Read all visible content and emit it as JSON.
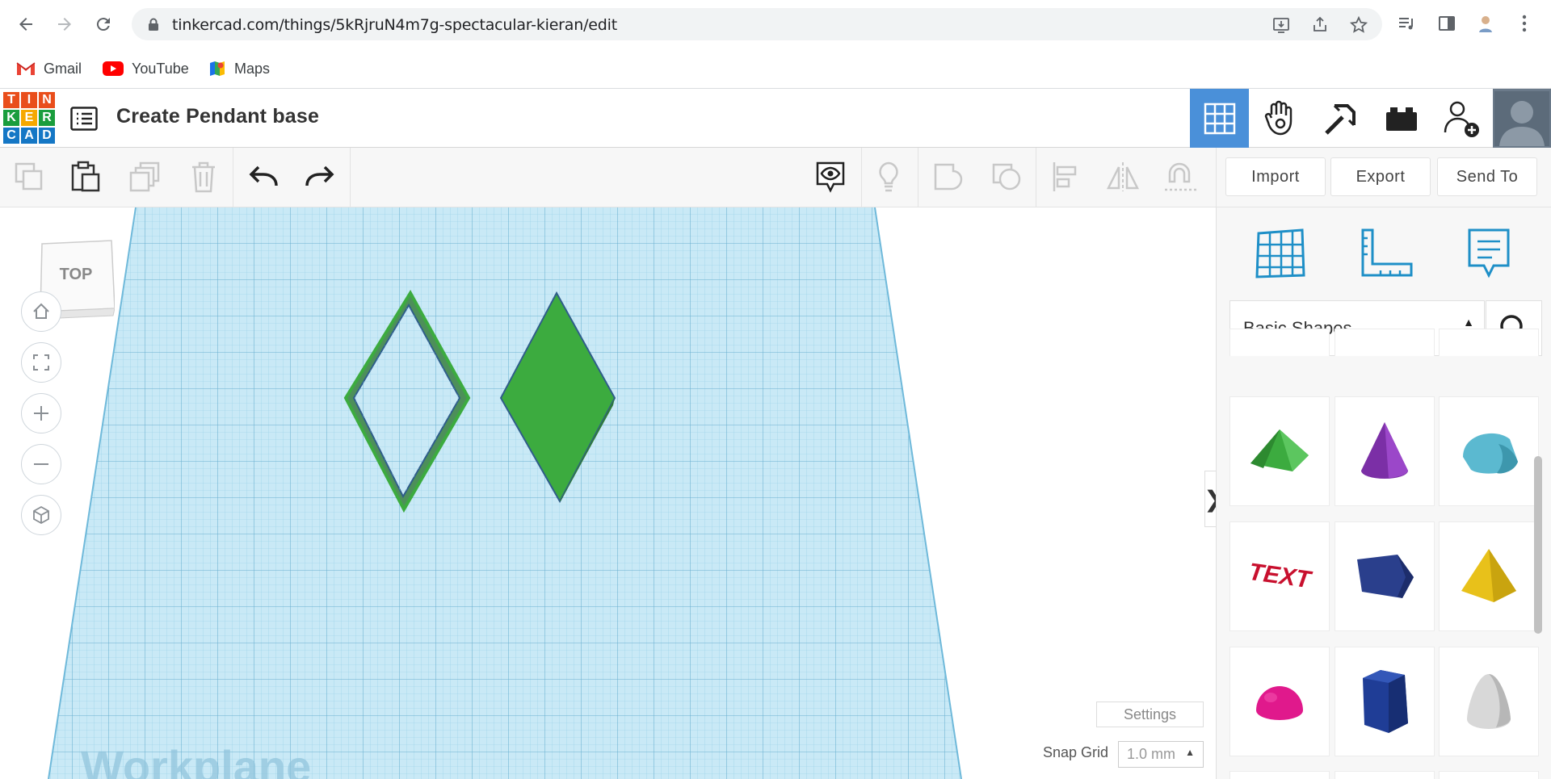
{
  "browser": {
    "url": "tinkercad.com/things/5kRjruN4m7g-spectacular-kieran/edit",
    "bookmarks": [
      {
        "label": "Gmail"
      },
      {
        "label": "YouTube"
      },
      {
        "label": "Maps"
      }
    ]
  },
  "header": {
    "logo_letters": [
      "T",
      "I",
      "N",
      "K",
      "E",
      "R",
      "C",
      "A",
      "D"
    ],
    "logo_colors": [
      "#e94e1b",
      "#e94e1b",
      "#e94e1b",
      "#1a9d3d",
      "#f6a800",
      "#1a9d3d",
      "#1577c5",
      "#1577c5",
      "#1577c5"
    ],
    "title": "Create Pendant base",
    "nav_icons": [
      "3d-design-grid-icon",
      "circuits-hand-icon",
      "minecraft-pickaxe-icon",
      "lego-bricks-icon",
      "add-user-icon",
      "avatar"
    ]
  },
  "toolbar": {
    "import_label": "Import",
    "export_label": "Export",
    "sendto_label": "Send To"
  },
  "workspace": {
    "viewcube_label": "TOP",
    "workplane_label": "Workplane",
    "settings_label": "Settings",
    "snap_grid_label": "Snap Grid",
    "snap_grid_value": "1.0 mm"
  },
  "panel": {
    "category": "Basic Shapes",
    "shapes": [
      "roof",
      "cone",
      "half-cylinder",
      "text",
      "polygon",
      "pyramid",
      "half-sphere",
      "hexagonal-prism",
      "paraboloid"
    ]
  },
  "colors": {
    "accent_blue": "#4a90d9",
    "shape_green": "#3cab3f",
    "grid_blue": "#a9d8ec"
  }
}
